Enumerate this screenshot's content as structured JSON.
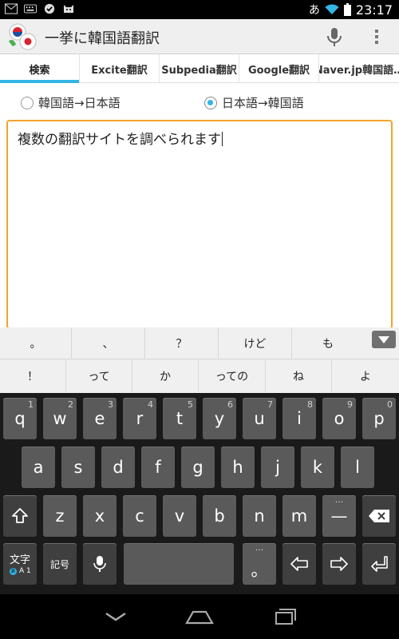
{
  "status_bar": {
    "ime_indicator": "あ",
    "time": "23:17",
    "icons": [
      "gmail-icon",
      "keyboard-icon",
      "checkmark-icon",
      "cat-icon",
      "wifi-icon",
      "battery-icon"
    ]
  },
  "action_bar": {
    "title": "一挙に韓国語翻訳",
    "icons": [
      "app-flags-icon",
      "microphone-icon",
      "overflow-menu-icon"
    ]
  },
  "tabs": [
    {
      "label": "検索",
      "selected": true
    },
    {
      "label": "Excite翻訳",
      "selected": false
    },
    {
      "label": "Subpedia翻訳",
      "selected": false
    },
    {
      "label": "Google翻訳",
      "selected": false
    },
    {
      "label": "Naver.jp韓国語…",
      "selected": false
    }
  ],
  "direction": {
    "options": [
      {
        "label": "韓国語→日本語",
        "checked": false
      },
      {
        "label": "日本語→韓国語",
        "checked": true
      }
    ]
  },
  "input": {
    "value": "複数の翻訳サイトを調べられます"
  },
  "suggestions": {
    "row1": [
      "。",
      "、",
      "？",
      "けど",
      "も"
    ],
    "row2": [
      "！",
      "って",
      "か",
      "っての",
      "ね",
      "よ"
    ]
  },
  "keyboard": {
    "row1": [
      {
        "key": "q",
        "alt": "1"
      },
      {
        "key": "w",
        "alt": "2"
      },
      {
        "key": "e",
        "alt": "3"
      },
      {
        "key": "r",
        "alt": "4"
      },
      {
        "key": "t",
        "alt": "5"
      },
      {
        "key": "y",
        "alt": "6"
      },
      {
        "key": "u",
        "alt": "7"
      },
      {
        "key": "i",
        "alt": "8"
      },
      {
        "key": "o",
        "alt": "9"
      },
      {
        "key": "p",
        "alt": "0"
      }
    ],
    "row2": [
      "a",
      "s",
      "d",
      "f",
      "g",
      "h",
      "j",
      "k",
      "l"
    ],
    "row3": [
      "z",
      "x",
      "c",
      "v",
      "b",
      "n",
      "m"
    ],
    "dash_key": "—",
    "dash_alt": "···",
    "period_key": "。",
    "period_alt": "···",
    "lang_key": {
      "top": "文字",
      "bottom": "A 1"
    },
    "symbols_key": "記号"
  },
  "colors": {
    "accent": "#33b5e5",
    "text_border": "#f3a32d",
    "keyboard_bg": "#1a1a1a",
    "key_bg": "#5a5a5a"
  }
}
